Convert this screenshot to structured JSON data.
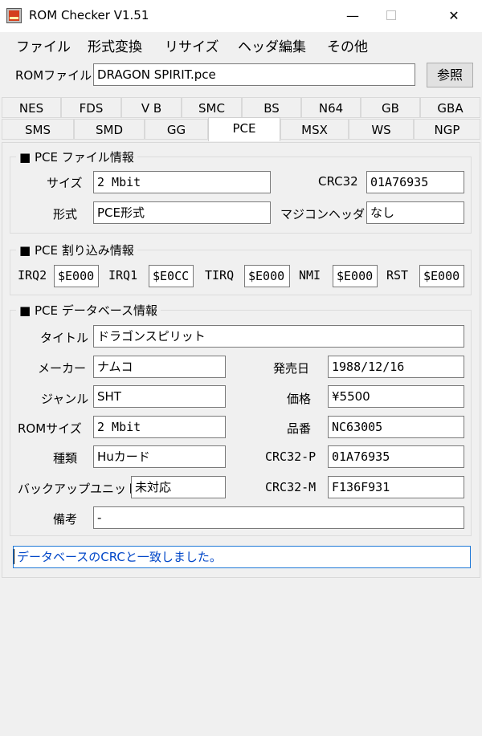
{
  "window": {
    "title": "ROM Checker V1.51",
    "minimize": "—",
    "close": "✕"
  },
  "menu": [
    "ファイル",
    "形式変換",
    "リサイズ",
    "ヘッダ編集",
    "その他"
  ],
  "rom": {
    "label": "ROMファイル",
    "value": "DRAGON SPIRIT.pce",
    "browse": "参照"
  },
  "tabs": {
    "row1": [
      "NES",
      "FDS",
      "V B",
      "SMC",
      "BS",
      "N64",
      "GB",
      "GBA"
    ],
    "row2": [
      "SMS",
      "SMD",
      "GG",
      "PCE",
      "MSX",
      "WS",
      "NGP"
    ],
    "active": "PCE"
  },
  "file_info": {
    "title": "■ PCE ファイル情報",
    "size_label": "サイズ",
    "size": "2 Mbit",
    "crc32_label": "CRC32",
    "crc32": "01A76935",
    "format_label": "形式",
    "format": "PCE形式",
    "magicon_label": "マジコンヘッダ",
    "magicon": "なし"
  },
  "irq_info": {
    "title": "■ PCE 割り込み情報",
    "irq2_label": "IRQ2",
    "irq2": "$E000",
    "irq1_label": "IRQ1",
    "irq1": "$E0CC",
    "tirq_label": "TIRQ",
    "tirq": "$E000",
    "nmi_label": "NMI",
    "nmi": "$E000",
    "rst_label": "RST",
    "rst": "$E000"
  },
  "db_info": {
    "title": "■ PCE データベース情報",
    "title_label": "タイトル",
    "game_title": "ドラゴンスピリット",
    "maker_label": "メーカー",
    "maker": "ナムコ",
    "release_label": "発売日",
    "release": "1988/12/16",
    "genre_label": "ジャンル",
    "genre": "SHT",
    "price_label": "価格",
    "price": "¥5500",
    "romsize_label": "ROMサイズ",
    "romsize": "2 Mbit",
    "product_label": "品番",
    "product": "NC63005",
    "type_label": "種類",
    "type": "Huカード",
    "crc32p_label": "CRC32-P",
    "crc32p": "01A76935",
    "backup_label": "バックアップユニット",
    "backup": "未対応",
    "crc32m_label": "CRC32-M",
    "crc32m": "F136F931",
    "note_label": "備考",
    "note": "-"
  },
  "status": "データベースのCRCと一致しました。"
}
